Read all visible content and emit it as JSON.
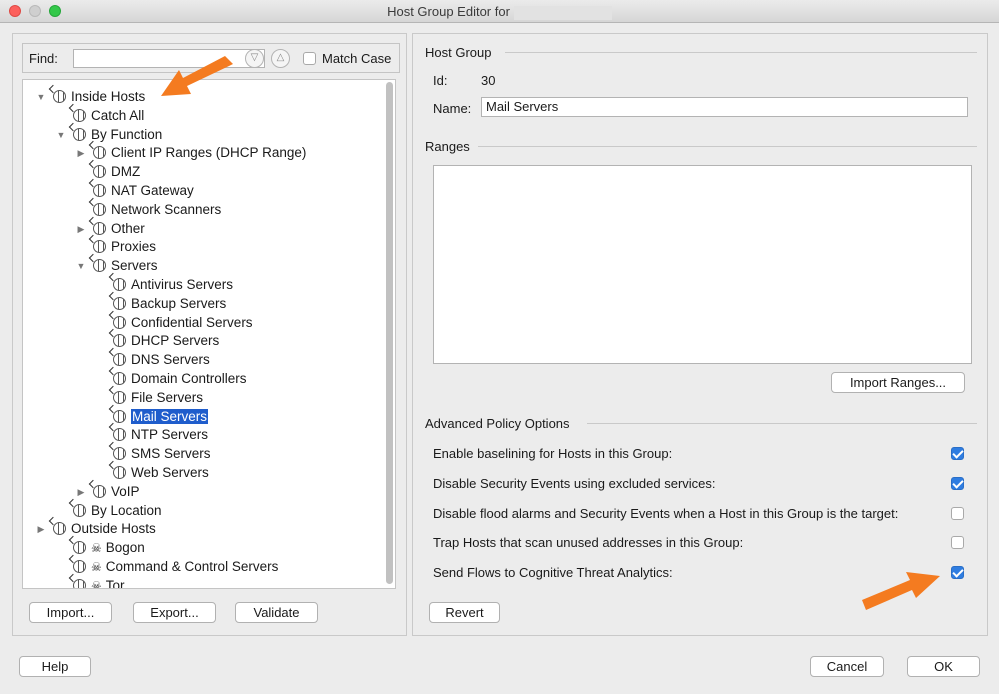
{
  "window": {
    "title": "Host Group Editor for"
  },
  "find": {
    "label": "Find:",
    "value": "",
    "match_case_label": "Match Case",
    "match_case_checked": false
  },
  "tree": {
    "items": [
      {
        "label": "Inside Hosts",
        "arrow": "▼",
        "icon": "globe-icon"
      },
      {
        "label": "Catch All",
        "arrow": "",
        "icon": "globe-icon"
      },
      {
        "label": "By Function",
        "arrow": "▼",
        "icon": "globe-icon"
      },
      {
        "label": "Client IP Ranges (DHCP Range)",
        "arrow": "▶",
        "icon": "globe-icon"
      },
      {
        "label": "DMZ",
        "arrow": "",
        "icon": "globe-icon"
      },
      {
        "label": "NAT Gateway",
        "arrow": "",
        "icon": "globe-icon"
      },
      {
        "label": "Network Scanners",
        "arrow": "",
        "icon": "globe-icon"
      },
      {
        "label": "Other",
        "arrow": "▶",
        "icon": "globe-icon"
      },
      {
        "label": "Proxies",
        "arrow": "",
        "icon": "globe-icon"
      },
      {
        "label": "Servers",
        "arrow": "▼",
        "icon": "globe-icon"
      },
      {
        "label": "Antivirus Servers",
        "arrow": "",
        "icon": "globe-icon"
      },
      {
        "label": "Backup Servers",
        "arrow": "",
        "icon": "globe-icon"
      },
      {
        "label": "Confidential Servers",
        "arrow": "",
        "icon": "globe-icon"
      },
      {
        "label": "DHCP Servers",
        "arrow": "",
        "icon": "globe-icon"
      },
      {
        "label": "DNS Servers",
        "arrow": "",
        "icon": "globe-icon"
      },
      {
        "label": "Domain Controllers",
        "arrow": "",
        "icon": "globe-icon"
      },
      {
        "label": "File Servers",
        "arrow": "",
        "icon": "globe-icon"
      },
      {
        "label": "Mail Servers",
        "arrow": "",
        "icon": "globe-icon",
        "selected": true
      },
      {
        "label": "NTP Servers",
        "arrow": "",
        "icon": "globe-icon"
      },
      {
        "label": "SMS Servers",
        "arrow": "",
        "icon": "globe-icon"
      },
      {
        "label": "Web Servers",
        "arrow": "",
        "icon": "globe-icon"
      },
      {
        "label": "VoIP",
        "arrow": "▶",
        "icon": "globe-icon"
      },
      {
        "label": "By Location",
        "arrow": "",
        "icon": "globe-icon"
      },
      {
        "label": "Outside Hosts",
        "arrow": "▶",
        "icon": "globe-icon"
      },
      {
        "label": "Bogon",
        "arrow": "",
        "icon": "skull-globe-icon"
      },
      {
        "label": "Command & Control Servers",
        "arrow": "",
        "icon": "skull-globe-icon"
      },
      {
        "label": "Tor",
        "arrow": "",
        "icon": "skull-globe-icon"
      }
    ]
  },
  "left_buttons": {
    "import": "Import...",
    "export": "Export...",
    "validate": "Validate"
  },
  "host_group": {
    "section_title": "Host Group",
    "id_label": "Id:",
    "id_value": "30",
    "name_label": "Name:",
    "name_value": "Mail Servers"
  },
  "ranges": {
    "section_title": "Ranges",
    "import_button": "Import Ranges..."
  },
  "advanced": {
    "section_title": "Advanced Policy Options",
    "options": [
      {
        "label": "Enable baselining for Hosts in this Group:",
        "checked": true
      },
      {
        "label": "Disable Security Events using excluded services:",
        "checked": true
      },
      {
        "label": "Disable flood alarms and Security Events when a Host in this Group is the target:",
        "checked": false
      },
      {
        "label": "Trap Hosts that scan unused addresses in this Group:",
        "checked": false
      },
      {
        "label": "Send Flows to Cognitive Threat Analytics:",
        "checked": true
      }
    ],
    "revert_button": "Revert"
  },
  "footer": {
    "help": "Help",
    "cancel": "Cancel",
    "ok": "OK"
  },
  "colors": {
    "selection": "#1f5dcc",
    "checkbox_on": "#2f7de1",
    "annotation_arrow": "#f47b20"
  }
}
